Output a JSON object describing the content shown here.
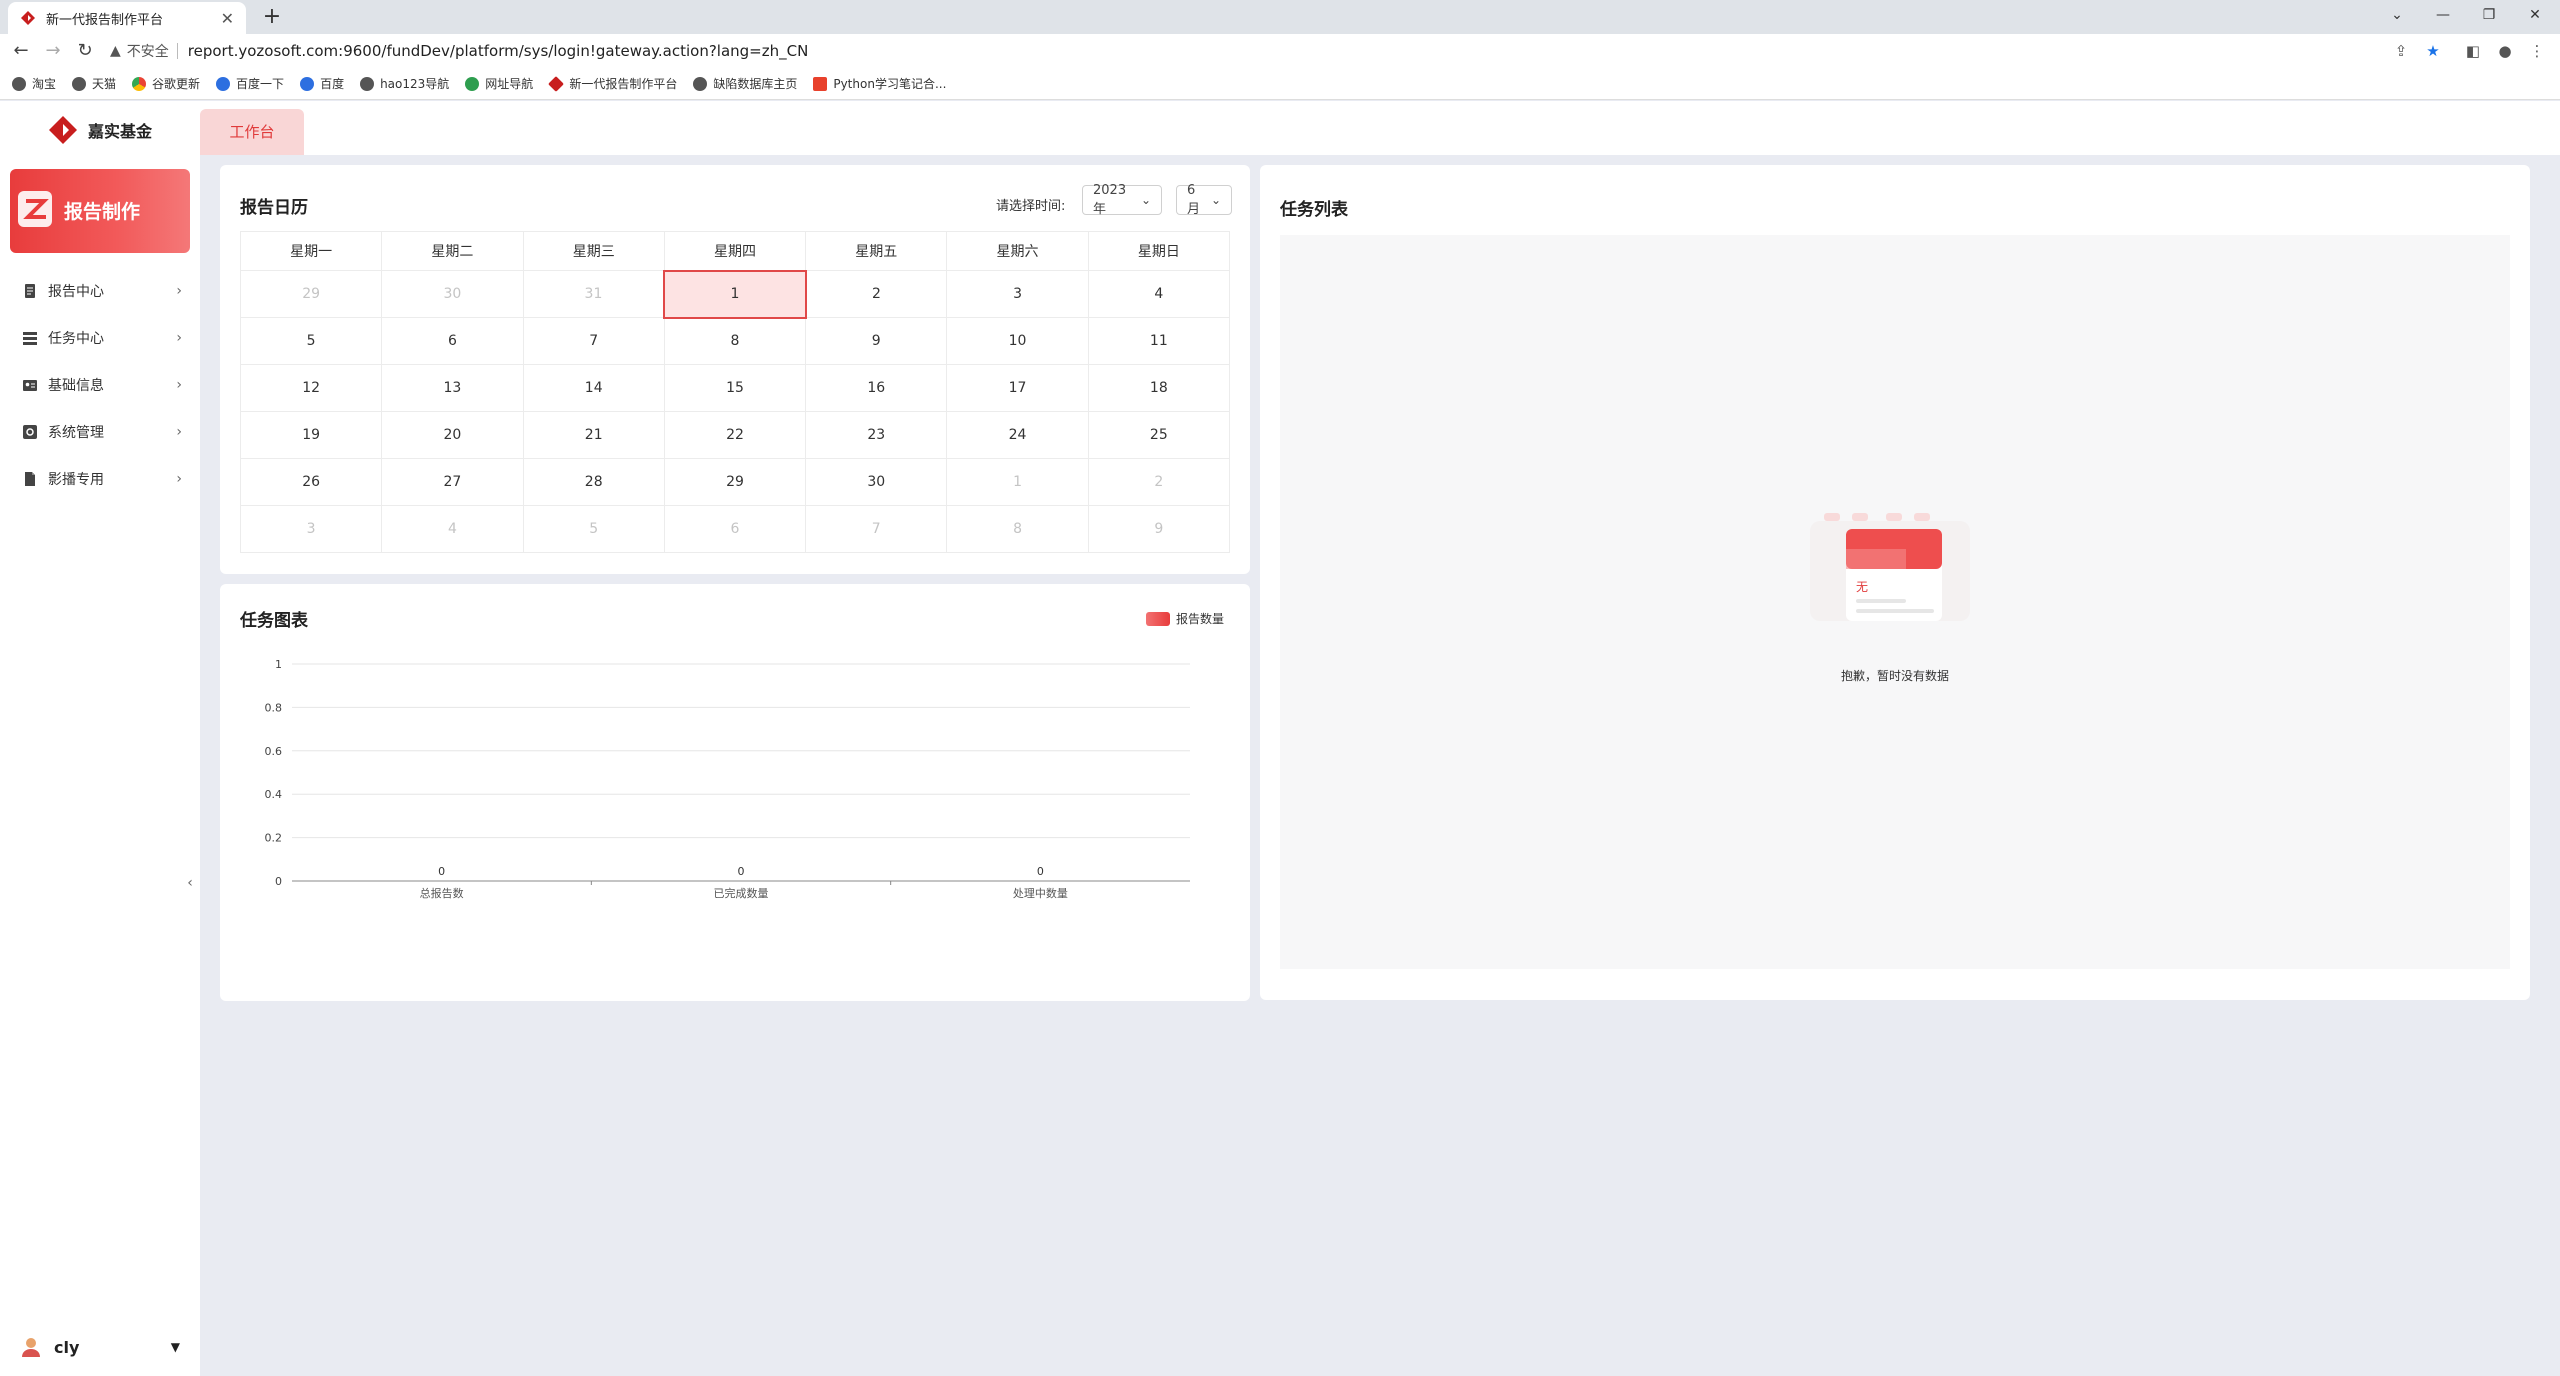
{
  "browser": {
    "tab_title": "新一代报告制作平台",
    "tab_close": "✕",
    "new_tab": "+",
    "insecure_label": "不安全",
    "url": "report.yozosoft.com:9600/fundDev/platform/sys/login!gateway.action?lang=zh_CN",
    "bookmarks": [
      "淘宝",
      "天猫",
      "谷歌更新",
      "百度一下",
      "百度",
      "hao123导航",
      "网址导航",
      "新一代报告制作平台",
      "缺陷数据库主页",
      "Python学习笔记合..."
    ]
  },
  "app": {
    "brand": "嘉实基金",
    "workspace_tab": "工作台",
    "product_title": "报告制作",
    "menu": [
      {
        "label": "报告中心",
        "icon": "document-icon"
      },
      {
        "label": "任务中心",
        "icon": "server-list-icon"
      },
      {
        "label": "基础信息",
        "icon": "id-card-icon"
      },
      {
        "label": "系统管理",
        "icon": "settings-icon"
      },
      {
        "label": "影播专用",
        "icon": "file-icon"
      }
    ],
    "user": "cly"
  },
  "calendar": {
    "title": "报告日历",
    "select_label": "请选择时间:",
    "year": "2023年",
    "month": "6月",
    "weekdays": [
      "星期一",
      "星期二",
      "星期三",
      "星期四",
      "星期五",
      "星期六",
      "星期日"
    ],
    "weeks": [
      [
        "29",
        "30",
        "31",
        "1",
        "2",
        "3",
        "4"
      ],
      [
        "5",
        "6",
        "7",
        "8",
        "9",
        "10",
        "11"
      ],
      [
        "12",
        "13",
        "14",
        "15",
        "16",
        "17",
        "18"
      ],
      [
        "19",
        "20",
        "21",
        "22",
        "23",
        "24",
        "25"
      ],
      [
        "26",
        "27",
        "28",
        "29",
        "30",
        "1",
        "2"
      ],
      [
        "3",
        "4",
        "5",
        "6",
        "7",
        "8",
        "9"
      ]
    ],
    "other_month": [
      [
        true,
        true,
        true,
        false,
        false,
        false,
        false
      ],
      [
        false,
        false,
        false,
        false,
        false,
        false,
        false
      ],
      [
        false,
        false,
        false,
        false,
        false,
        false,
        false
      ],
      [
        false,
        false,
        false,
        false,
        false,
        false,
        false
      ],
      [
        false,
        false,
        false,
        false,
        false,
        true,
        true
      ],
      [
        true,
        true,
        true,
        true,
        true,
        true,
        true
      ]
    ],
    "selected_day": "1"
  },
  "chart": {
    "title": "任务图表",
    "legend": "报告数量"
  },
  "chart_data": {
    "type": "bar",
    "categories": [
      "总报告数",
      "已完成数量",
      "处理中数量"
    ],
    "series": [
      {
        "name": "报告数量",
        "values": [
          0,
          0,
          0
        ]
      }
    ],
    "ylim": [
      0,
      1
    ],
    "yticks": [
      "0",
      "0.2",
      "0.4",
      "0.6",
      "0.8",
      "1"
    ],
    "grid": true,
    "legend_position": "top-right"
  },
  "tasklist": {
    "title": "任务列表",
    "empty_text": "抱歉，暂时没有数据",
    "empty_badge": "无"
  }
}
